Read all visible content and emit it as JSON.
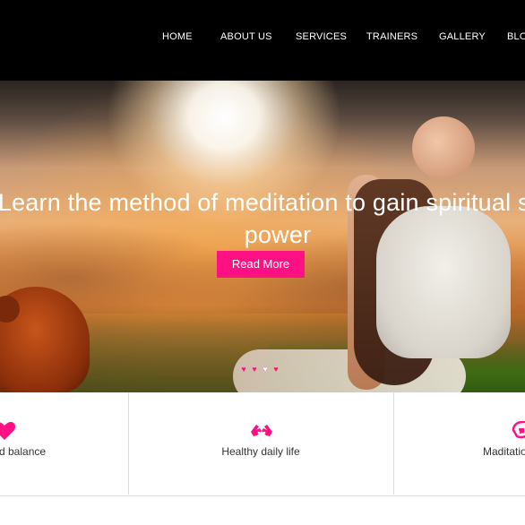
{
  "nav": {
    "items": [
      {
        "label": "HOME"
      },
      {
        "label": "ABOUT US"
      },
      {
        "label": "SERVICES"
      },
      {
        "label": "TRAINERS"
      },
      {
        "label": "GALLERY"
      },
      {
        "label": "BLO"
      }
    ]
  },
  "hero": {
    "title_line1": "Learn the method of meditation to gain spiritual sou",
    "title_line2": "power",
    "cta_label": "Read More",
    "dots": [
      "♥",
      "♥",
      "♥",
      "♥"
    ],
    "active_dot": 2
  },
  "features": [
    {
      "label": "d balance",
      "icon": "heart-icon"
    },
    {
      "label": "Healthy daily life",
      "icon": "hands-icon"
    },
    {
      "label": "Maditatio",
      "icon": "meditation-icon"
    }
  ],
  "colors": {
    "accent": "#ff1184",
    "nav_bg": "#000000",
    "nav_text": "#ffffff"
  }
}
